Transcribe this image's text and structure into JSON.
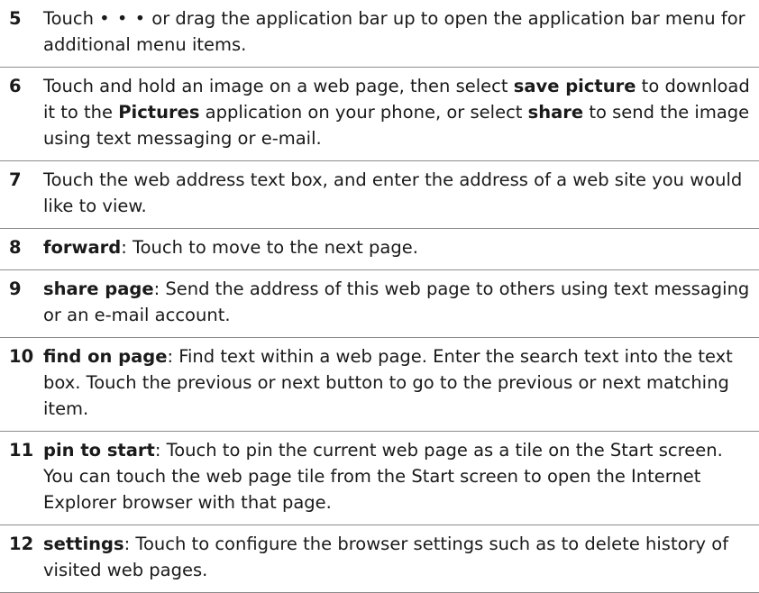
{
  "rows": [
    {
      "number": "5",
      "segments": [
        {
          "text": "Touch ",
          "bold": false
        },
        {
          "text": "• • •",
          "bold": false,
          "icon": "ellipsis-dots-icon"
        },
        {
          "text": " or drag the application bar up to open the application bar menu for additional menu items.",
          "bold": false
        }
      ]
    },
    {
      "number": "6",
      "segments": [
        {
          "text": "Touch and hold an image on a web page, then select ",
          "bold": false
        },
        {
          "text": "save picture",
          "bold": true
        },
        {
          "text": " to download it to the ",
          "bold": false
        },
        {
          "text": "Pictures",
          "bold": true
        },
        {
          "text": " application on your phone, or select ",
          "bold": false
        },
        {
          "text": "share",
          "bold": true
        },
        {
          "text": " to send the image using text messaging or e-mail.",
          "bold": false
        }
      ]
    },
    {
      "number": "7",
      "segments": [
        {
          "text": "Touch the web address text box, and enter the address of a web site you would like to view.",
          "bold": false
        }
      ]
    },
    {
      "number": "8",
      "segments": [
        {
          "text": "forward",
          "bold": true
        },
        {
          "text": ": Touch to move to the next page.",
          "bold": false
        }
      ]
    },
    {
      "number": "9",
      "segments": [
        {
          "text": "share page",
          "bold": true
        },
        {
          "text": ": Send the address of this web page to others using text messaging or an e-mail account.",
          "bold": false
        }
      ]
    },
    {
      "number": "10",
      "segments": [
        {
          "text": "find on page",
          "bold": true
        },
        {
          "text": ": Find text within a web page. Enter the search text into the text box. Touch the previous or next button to go to the previous or next matching item.",
          "bold": false
        }
      ]
    },
    {
      "number": "11",
      "segments": [
        {
          "text": "pin to start",
          "bold": true
        },
        {
          "text": ": Touch to pin the current web page as a tile on the Start screen. You can touch the web page tile from the Start screen to open the Internet Explorer browser with that page.",
          "bold": false
        }
      ]
    },
    {
      "number": "12",
      "segments": [
        {
          "text": "settings",
          "bold": true
        },
        {
          "text": ": Touch to configure the browser settings such as to delete history of visited web pages.",
          "bold": false
        }
      ]
    }
  ]
}
